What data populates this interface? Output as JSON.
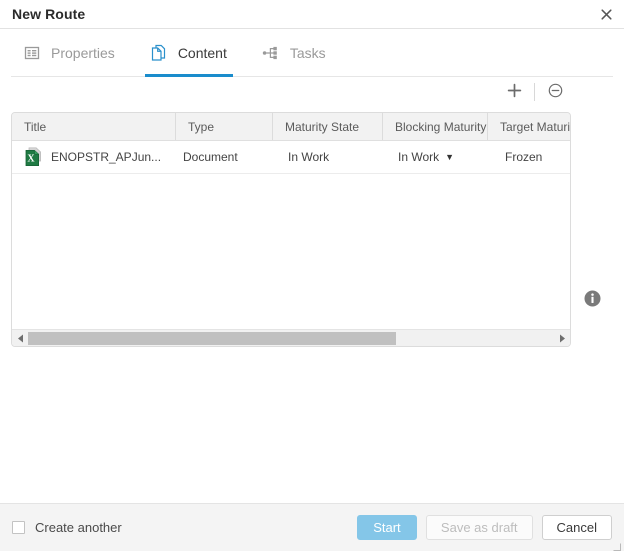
{
  "window": {
    "title": "New Route",
    "close_icon": "close-icon"
  },
  "tabs": [
    {
      "label": "Properties",
      "icon": "properties-grid-icon",
      "active": false
    },
    {
      "label": "Content",
      "icon": "document-pages-icon",
      "active": true
    },
    {
      "label": "Tasks",
      "icon": "tasks-network-icon",
      "active": false
    }
  ],
  "toolbar": {
    "add_label": "+",
    "add_icon": "plus-icon",
    "remove_icon": "minus-circle-icon"
  },
  "info": {
    "icon": "info-circle-icon"
  },
  "table": {
    "columns": [
      "Title",
      "Type",
      "Maturity State",
      "Blocking Maturity",
      "Target Maturit"
    ],
    "rows": [
      {
        "icon": "excel-document-icon",
        "title": "ENOPSTR_APJun...",
        "type": "Document",
        "maturity_state": "In Work",
        "blocking_maturity": "In Work",
        "blocking_caret": "▼",
        "target_maturity": "Frozen"
      }
    ],
    "scrollbar": {
      "left_arrow_icon": "scroll-left-icon",
      "right_arrow_icon": "scroll-right-icon",
      "thumb_percent": 70
    }
  },
  "footer": {
    "create_another_label": "Create another",
    "start_label": "Start",
    "save_draft_label": "Save as draft",
    "cancel_label": "Cancel"
  },
  "colors": {
    "accent": "#1a8ccc",
    "start_button": "#84c6e8",
    "header_bg": "#f2f2f2",
    "footer_bg": "#f4f4f4",
    "excel_green": "#1f7a43"
  }
}
